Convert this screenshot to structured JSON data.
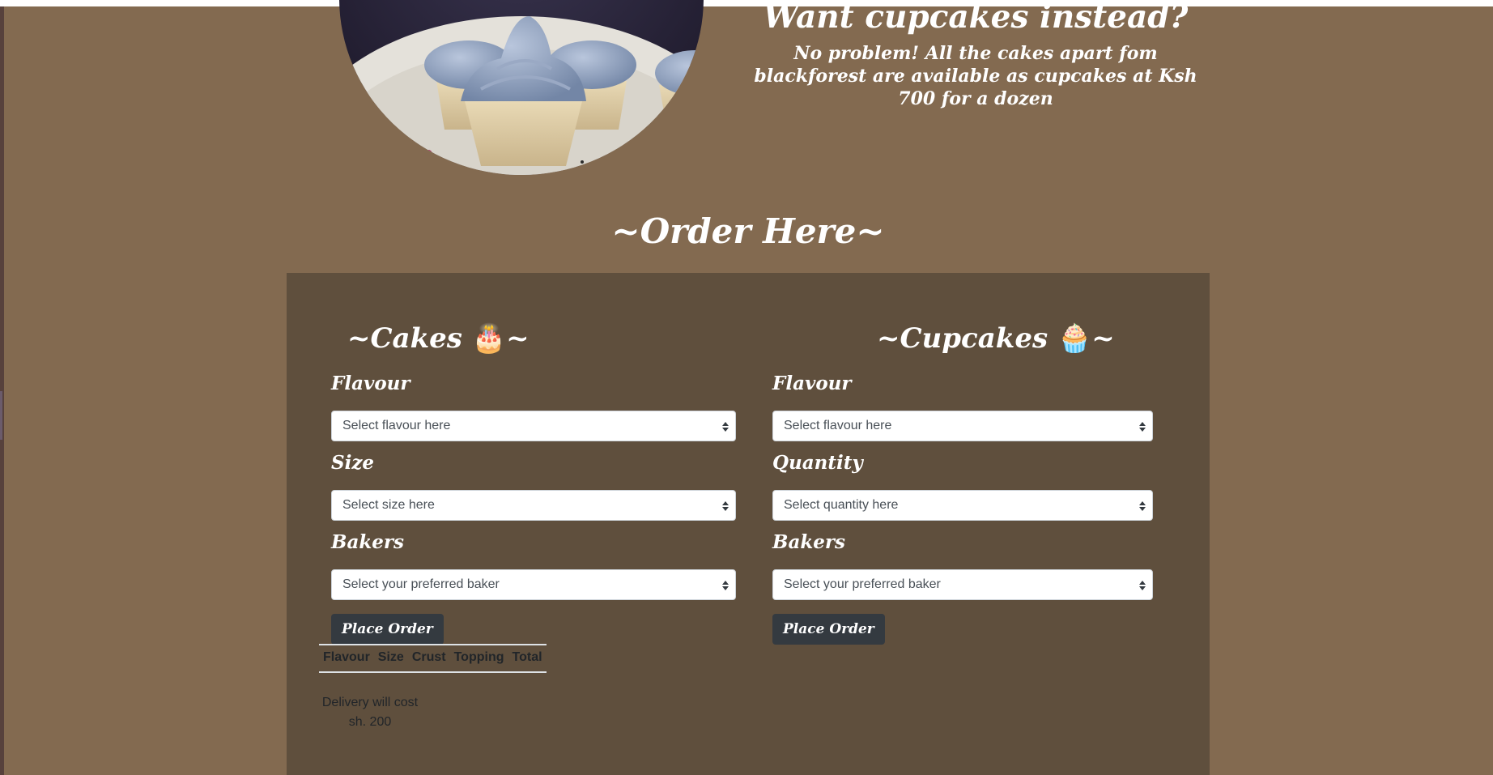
{
  "promo": {
    "title": "Want cupcakes instead?",
    "text": "No problem! All the cakes apart fom blackforest are available as cupcakes at Ksh 700 for a dozen"
  },
  "order_section": {
    "heading": "~Order Here~"
  },
  "cakes": {
    "title": "~Cakes",
    "title_end": "~",
    "emoji": "🎂",
    "flavour_label": "Flavour",
    "flavour_select": "Select flavour here",
    "size_label": "Size",
    "size_select": "Select size here",
    "bakers_label": "Bakers",
    "bakers_select": "Select your preferred baker",
    "place_order": "Place Order",
    "table_headers": [
      "Flavour",
      "Size",
      "Crust",
      "Topping",
      "Total"
    ],
    "delivery_text": "Delivery will cost",
    "delivery_amount": "sh. 200"
  },
  "cupcakes": {
    "title": "~Cupcakes",
    "title_end": "~",
    "emoji": "🧁",
    "flavour_label": "Flavour",
    "flavour_select": "Select flavour here",
    "quantity_label": "Quantity",
    "quantity_select": "Select quantity here",
    "bakers_label": "Bakers",
    "bakers_select": "Select your preferred baker",
    "place_order": "Place Order"
  }
}
